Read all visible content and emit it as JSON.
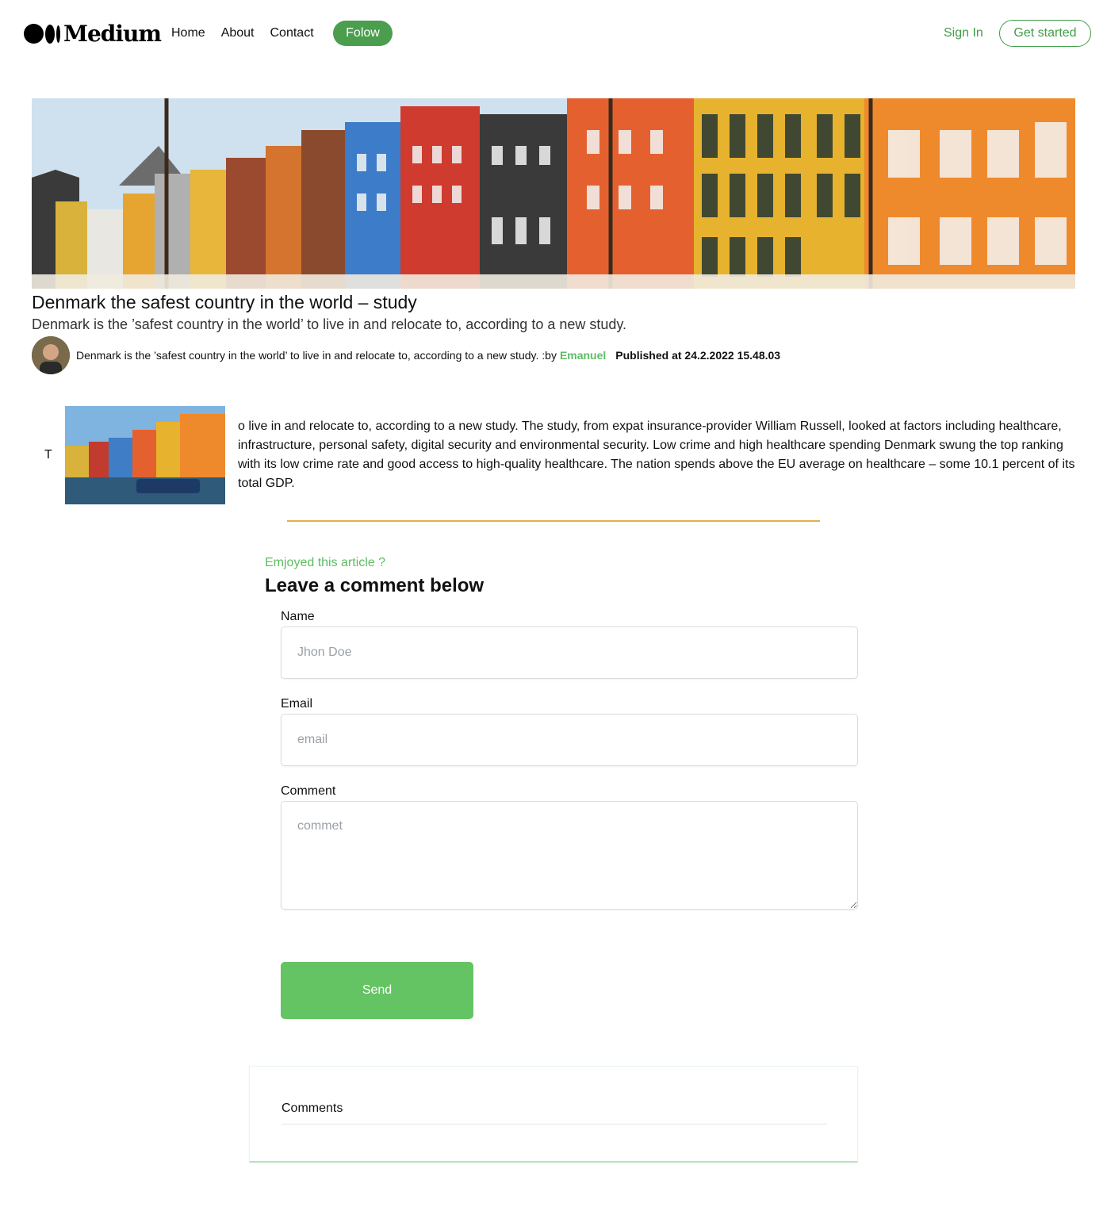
{
  "header": {
    "logo_text": "Medium",
    "nav": [
      "Home",
      "About",
      "Contact"
    ],
    "follow_label": "Folow",
    "signin_label": "Sign In",
    "get_started_label": "Get started"
  },
  "article": {
    "title": "Denmark the safest country in the world – study",
    "subtitle": "Denmark is the ’safest country in the world’ to live in and relocate to, according to a new study.",
    "meta_text": "Denmark is the ’safest country in the world’ to live in and relocate to, according to a new study. :by",
    "author": "Emanuel",
    "published": "Published at 24.2.2022 15.48.03",
    "dropcap": "T",
    "body": "o live in and relocate to, according to a new study. The study, from expat insurance-provider William Russell, looked at factors including healthcare, infrastructure, personal safety, digital security and environmental security. Low crime and high healthcare spending Denmark swung the top ranking with its low crime rate and good access to high-quality healthcare. The nation spends above the EU average on healthcare – some 10.1 percent of its total GDP."
  },
  "comment_form": {
    "eyebrow": "Emjoyed this article ?",
    "heading": "Leave a comment below",
    "name_label": "Name",
    "name_placeholder": "Jhon Doe",
    "email_label": "Email",
    "email_placeholder": "email",
    "comment_label": "Comment",
    "comment_placeholder": "commet",
    "send_label": "Send"
  },
  "comments": {
    "title": "Comments"
  },
  "colors": {
    "accent_green": "#4a9e4e",
    "button_green": "#64c463",
    "divider_gold": "#e3b04b"
  }
}
